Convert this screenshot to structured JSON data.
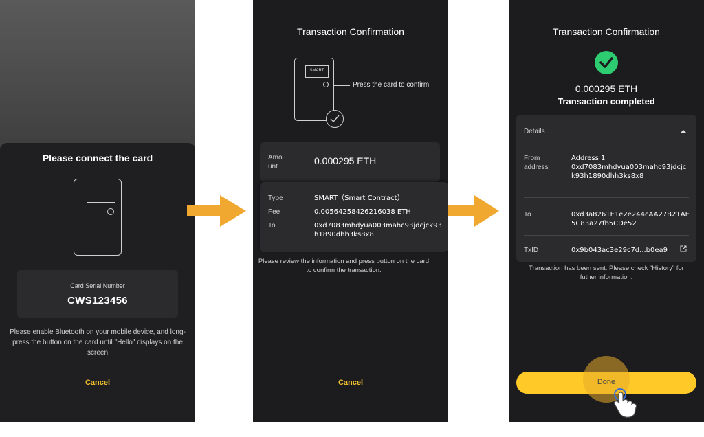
{
  "screen1": {
    "title": "Please connect the card",
    "serial_label": "Card Serial Number",
    "serial_value": "CWS123456",
    "instruction": "Please enable Bluetooth on your mobile device, and long-press the button on the card until \"Hello\" displays on the screen",
    "cancel_label": "Cancel"
  },
  "screen2": {
    "title": "Transaction Confirmation",
    "card_screen_text": "SMART",
    "press_label": "Press the card to confirm",
    "amount_label": "Amo\nunt",
    "amount_value": "0.000295 ETH",
    "rows": [
      {
        "key": "Type",
        "value": "SMART（Smart Contract）"
      },
      {
        "key": "Fee",
        "value": "0.00564258426216038 ETH"
      },
      {
        "key": "To",
        "value": "0xd7083mhdyua003mahc93jdcjck93h1890dhh3ks8x8"
      }
    ],
    "review_text": "Please review the information and press button on the card to confirm the transaction.",
    "cancel_label": "Cancel"
  },
  "screen3": {
    "title": "Transaction Confirmation",
    "amount": "0.000295 ETH",
    "status": "Transaction completed",
    "details_label": "Details",
    "from_key": "From address",
    "from_name": "Address 1",
    "from_value": "0xd7083mhdyua003mahc93jdcjck93h1890dhh3ks8x8",
    "to_key": "To",
    "to_value": "0xd3a8261E1e2e244cAA27B21AE5C83a27fb5CDe52",
    "txid_key": "TxID",
    "txid_value": "0x9b043ac3e29c7d...b0ea9",
    "note": "Transaction has been sent. Please check “History” for futher information.",
    "done_label": "Done"
  },
  "colors": {
    "accent": "#ffc928",
    "arrow": "#f0a830",
    "success": "#2ecc71",
    "background": "#1c1c1f"
  },
  "icons": [
    "check-circle-icon",
    "arrow-right-icon",
    "caret-up-icon",
    "external-link-icon",
    "hand-tap-icon",
    "card-device-icon"
  ]
}
